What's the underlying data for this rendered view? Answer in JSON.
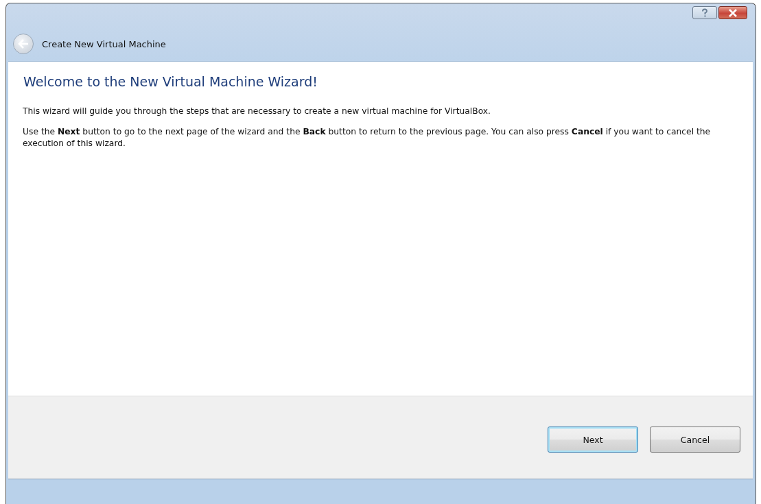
{
  "window": {
    "title": "Create New Virtual Machine"
  },
  "page": {
    "heading": "Welcome to the New Virtual Machine Wizard!",
    "paragraphs": [
      "This wizard will guide you through the steps that are necessary to create a new virtual machine for VirtualBox.",
      "Use the **Next** button to go to the next page of the wizard and the **Back** button to return to the previous page. You can also press **Cancel** if you want to cancel the execution of this wizard."
    ]
  },
  "buttons": [
    {
      "label": "Next",
      "default": true
    },
    {
      "label": "Cancel",
      "default": false
    }
  ]
}
